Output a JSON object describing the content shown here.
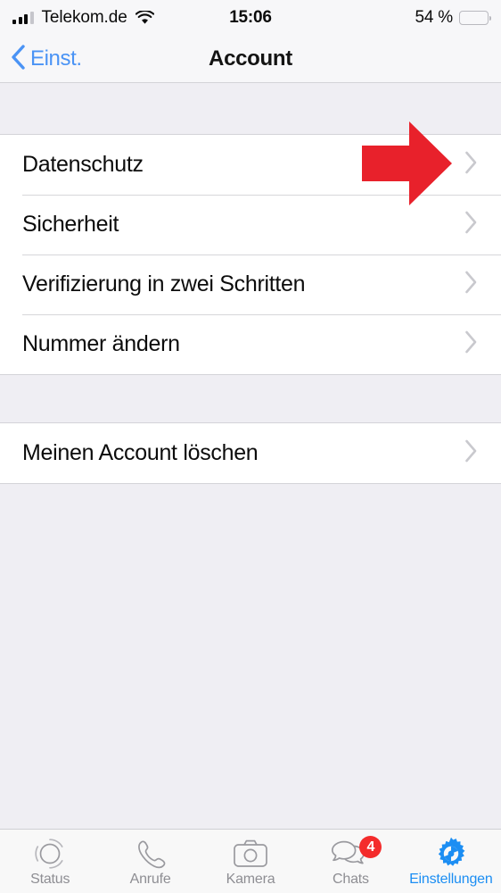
{
  "status_bar": {
    "carrier": "Telekom.de",
    "time": "15:06",
    "battery_text": "54 %",
    "battery_level": 54,
    "battery_color": "#fcca2f",
    "signal_icon": "signal-bars-icon",
    "wifi_icon": "wifi-icon"
  },
  "nav": {
    "back_label": "Einst.",
    "back_icon": "chevron-left-icon",
    "title": "Account",
    "accent_color": "#4a93f5"
  },
  "annotation": {
    "arrow_icon": "red-arrow-right-icon",
    "arrow_color": "#e8212b",
    "points_to": "Datenschutz"
  },
  "sections": [
    {
      "rows": [
        {
          "label": "Datenschutz",
          "chevron": "chevron-right-icon"
        },
        {
          "label": "Sicherheit",
          "chevron": "chevron-right-icon"
        },
        {
          "label": "Verifizierung in zwei Schritten",
          "chevron": "chevron-right-icon"
        },
        {
          "label": "Nummer ändern",
          "chevron": "chevron-right-icon"
        }
      ]
    },
    {
      "rows": [
        {
          "label": "Meinen Account löschen",
          "chevron": "chevron-right-icon"
        }
      ]
    }
  ],
  "tab_bar": {
    "selected_color": "#1c8ef3",
    "inactive_color": "#8e8e93",
    "tabs": [
      {
        "label": "Status",
        "icon": "status-rings-icon",
        "selected": false,
        "badge": null
      },
      {
        "label": "Anrufe",
        "icon": "phone-icon",
        "selected": false,
        "badge": null
      },
      {
        "label": "Kamera",
        "icon": "camera-icon",
        "selected": false,
        "badge": null
      },
      {
        "label": "Chats",
        "icon": "chat-bubbles-icon",
        "selected": false,
        "badge": "4"
      },
      {
        "label": "Einstellungen",
        "icon": "gear-icon",
        "selected": true,
        "badge": null
      }
    ]
  }
}
